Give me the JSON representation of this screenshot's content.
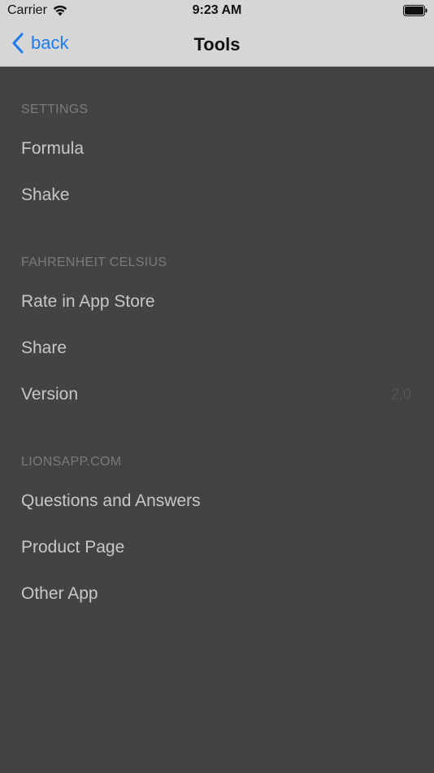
{
  "status_bar": {
    "carrier": "Carrier",
    "time": "9:23 AM"
  },
  "nav": {
    "back_label": "back",
    "title": "Tools"
  },
  "sections": [
    {
      "header": "SETTINGS",
      "items": [
        {
          "label": "Formula"
        },
        {
          "label": "Shake"
        }
      ]
    },
    {
      "header": "FAHRENHEIT CELSIUS",
      "items": [
        {
          "label": "Rate in App Store"
        },
        {
          "label": "Share"
        },
        {
          "label": "Version",
          "value": "2.0"
        }
      ]
    },
    {
      "header": "LIONSAPP.COM",
      "items": [
        {
          "label": "Questions and Answers"
        },
        {
          "label": "Product Page"
        },
        {
          "label": "Other App"
        }
      ]
    }
  ],
  "colors": {
    "background": "#434343",
    "bar_background": "#d6d6d6",
    "accent": "#1a7cf5",
    "row_text": "#c7c7c7",
    "header_text": "#7a7a7a"
  }
}
